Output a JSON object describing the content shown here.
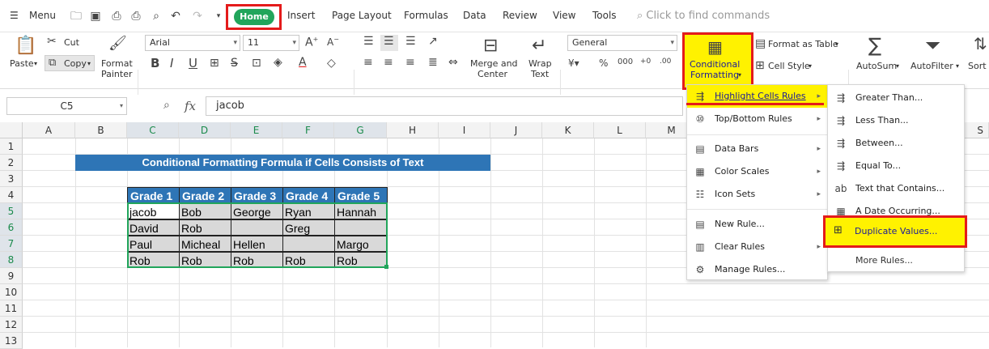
{
  "menubar": {
    "menu_label": "Menu",
    "tabs": [
      "Home",
      "Insert",
      "Page Layout",
      "Formulas",
      "Data",
      "Review",
      "View",
      "Tools"
    ],
    "search_placeholder": "Click to find commands"
  },
  "ribbon": {
    "paste": "Paste",
    "cut": "Cut",
    "copy": "Copy",
    "format_painter": [
      "Format",
      "Painter"
    ],
    "font_name": "Arial",
    "font_size": "11",
    "merge_center": [
      "Merge and",
      "Center"
    ],
    "wrap_text": [
      "Wrap",
      "Text"
    ],
    "number_format": "General",
    "conditional_formatting": [
      "Conditional",
      "Formatting"
    ],
    "format_as_table": "Format as Table",
    "cell_style": "Cell Style",
    "autosum": "AutoSum",
    "autofilter": "AutoFilter",
    "sort": "Sort"
  },
  "formula_bar": {
    "cell_ref": "C5",
    "fx": "fx",
    "content": "jacob"
  },
  "sheet": {
    "columns": [
      "A",
      "B",
      "C",
      "D",
      "E",
      "F",
      "G",
      "H",
      "I",
      "J",
      "K",
      "L",
      "M",
      "S"
    ],
    "rows": [
      "1",
      "2",
      "3",
      "4",
      "5",
      "6",
      "7",
      "8",
      "9",
      "10",
      "11",
      "12",
      "13"
    ],
    "title": "Conditional Formatting Formula if Cells Consists of Text",
    "headers": [
      "Grade 1",
      "Grade 2",
      "Grade 3",
      "Grade 4",
      "Grade 5"
    ],
    "cells": [
      [
        "jacob",
        "Bob",
        "George",
        "Ryan",
        "Hannah"
      ],
      [
        "David",
        "Rob",
        "",
        "Greg",
        ""
      ],
      [
        "Paul",
        "Micheal",
        "Hellen",
        "",
        "Margo"
      ],
      [
        "Rob",
        "Rob",
        "Rob",
        "Rob",
        "Rob"
      ]
    ]
  },
  "cf_menu": {
    "items": [
      "Highlight Cells Rules",
      "Top/Bottom Rules",
      "Data Bars",
      "Color Scales",
      "Icon Sets",
      "New Rule...",
      "Clear Rules",
      "Manage Rules..."
    ]
  },
  "highlight_submenu": {
    "items": [
      "Greater Than...",
      "Less Than...",
      "Between...",
      "Equal To...",
      "Text that Contains...",
      "A Date Occurring...",
      "Duplicate Values...",
      "More Rules..."
    ]
  },
  "colors": {
    "accent_green": "#21a55b",
    "highlight_yellow": "#fff200",
    "annotation_red": "#e41b1b",
    "table_header_blue": "#2e75b6"
  }
}
